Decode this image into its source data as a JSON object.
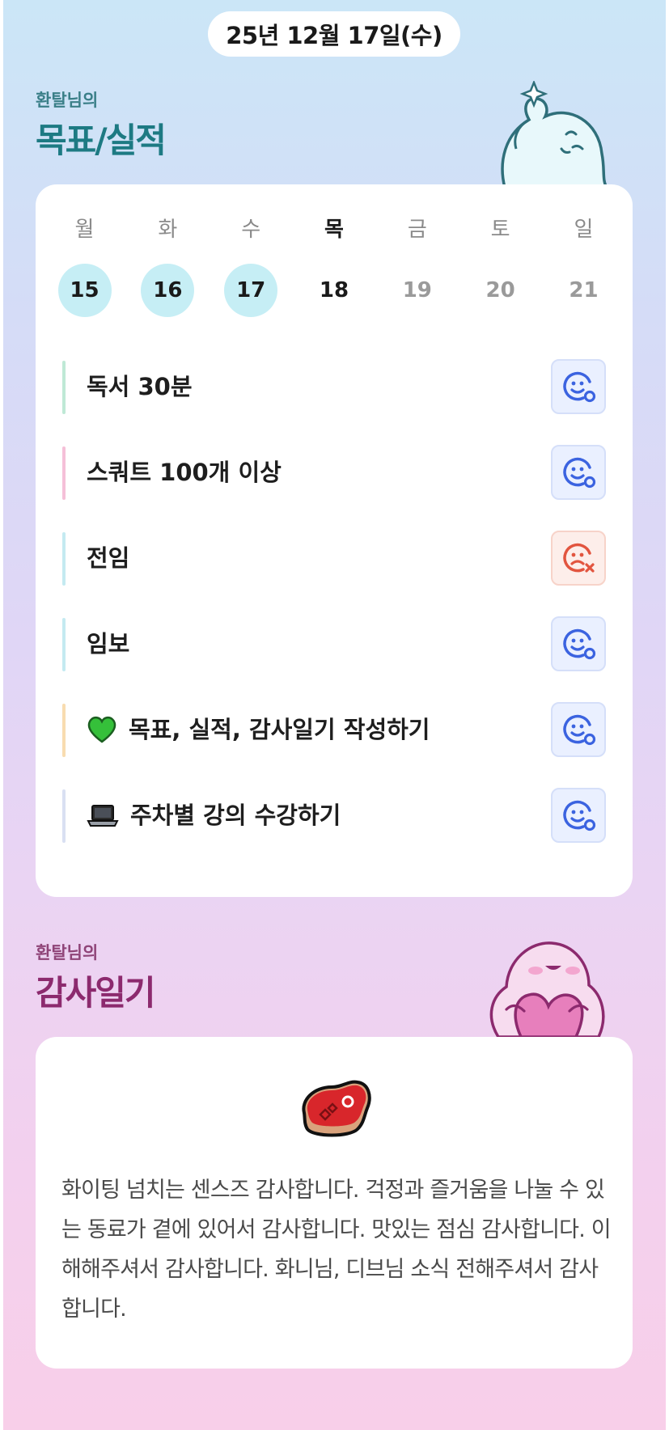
{
  "header": {
    "date": "25년 12월 17일(수)"
  },
  "goals_section": {
    "subtitle": "환탈님의",
    "title": "목표/실적",
    "week": [
      {
        "name": "월",
        "num": "15",
        "state": "done"
      },
      {
        "name": "화",
        "num": "16",
        "state": "done"
      },
      {
        "name": "수",
        "num": "17",
        "state": "done"
      },
      {
        "name": "목",
        "num": "18",
        "state": "today"
      },
      {
        "name": "금",
        "num": "19",
        "state": "future"
      },
      {
        "name": "토",
        "num": "20",
        "state": "future"
      },
      {
        "name": "일",
        "num": "21",
        "state": "future"
      }
    ],
    "goals": [
      {
        "text": "독서 30분",
        "bar_color": "#bfe9d6",
        "status": "success"
      },
      {
        "text": "스쿼트 100개 이상",
        "bar_color": "#f5c0d8",
        "status": "success"
      },
      {
        "text": "전임",
        "bar_color": "#c4eaf1",
        "status": "fail"
      },
      {
        "text": "임보",
        "bar_color": "#c4eaf1",
        "status": "success"
      },
      {
        "text": "목표, 실적, 감사일기 작성하기",
        "bar_color": "#f8dcb0",
        "status": "success",
        "emoji": "green-heart"
      },
      {
        "text": "주차별 강의 수강하기",
        "bar_color": "#d9e0f2",
        "status": "success",
        "emoji": "laptop"
      }
    ]
  },
  "diary_section": {
    "subtitle": "환탈님의",
    "title": "감사일기",
    "emoji": "meat",
    "text": "화이팅 넘치는 센스즈 감사합니다. 걱정과 즐거움을 나눌 수 있는 동료가 곁에 있어서 감사합니다. 맛있는 점심 감사합니다. 이해해주셔서 감사합니다. 화니님, 디브님 소식 전해주셔서 감사합니다."
  },
  "colors": {
    "goal_title": "#1d7a83",
    "diary_title": "#8c2a6e",
    "done_day": "#c6eef5",
    "status_ok": "#3b63e0",
    "status_fail": "#e2553f"
  }
}
